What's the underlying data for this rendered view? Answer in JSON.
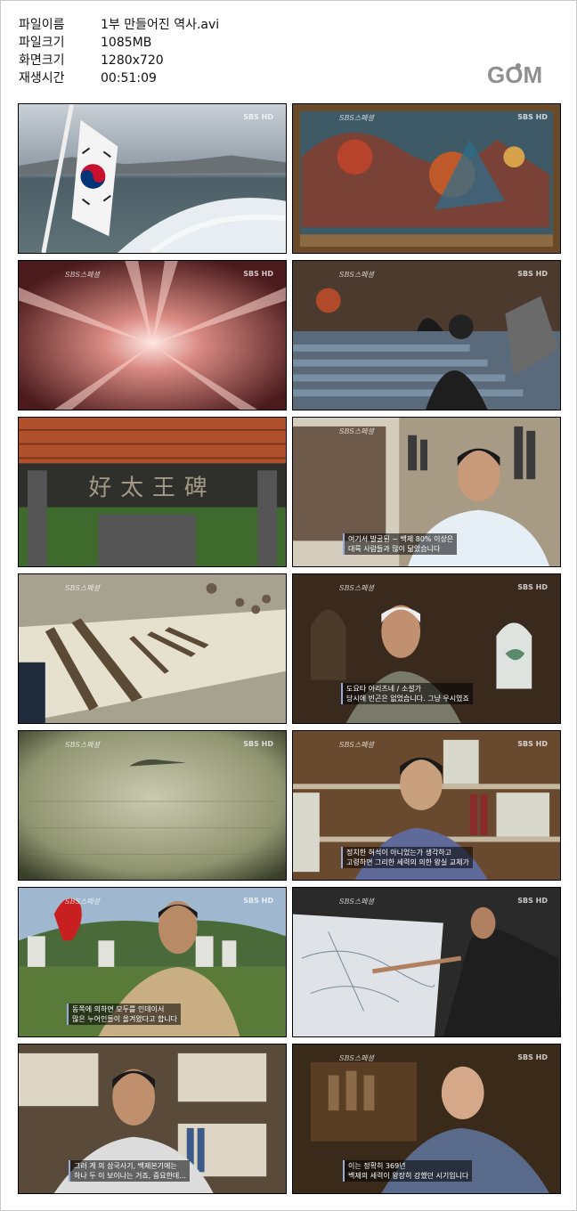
{
  "info": {
    "rows": [
      {
        "label": "파일이름",
        "value": "1부 만들어진 역사.avi"
      },
      {
        "label": "파일크기",
        "value": "1085MB"
      },
      {
        "label": "화면크기",
        "value": "1280x720"
      },
      {
        "label": "재생시간",
        "value": "00:51:09"
      }
    ]
  },
  "logo": {
    "text": "GOM"
  },
  "watermarks": {
    "left": "SBS스페셜",
    "right": "SBS HD"
  },
  "thumbnails": [
    {
      "scene": "ferry-flag",
      "captions": []
    },
    {
      "scene": "painting",
      "captions": []
    },
    {
      "scene": "light-rays",
      "captions": []
    },
    {
      "scene": "throne-room",
      "captions": []
    },
    {
      "scene": "gate-sign",
      "sign": "好太王碑",
      "captions": []
    },
    {
      "scene": "office-interview",
      "captions": [
        "여기서 발굴된 ~ 백제 80% 이상은",
        "대륙 사람들과 많이 닮았습니다"
      ]
    },
    {
      "scene": "museum-display",
      "captions": []
    },
    {
      "scene": "old-man-interview",
      "captions": [
        "도요타 아리츠네 / 소설가",
        "당시에 빈곤은 없었습니다. 그냥 우시였죠"
      ]
    },
    {
      "scene": "island-sea",
      "captions": []
    },
    {
      "scene": "bookshelf-interview",
      "captions": [
        "정치한 혀석이 아니었는가 생각하고",
        "고령하면 그리한 세력의 의한 왕실 교체가"
      ]
    },
    {
      "scene": "outdoor-interview",
      "captions": [
        "동쪽에 의하면 모두를 인데이서",
        "많은 누어인들이 올겨왔다고 합니다"
      ]
    },
    {
      "scene": "map-presentation",
      "captions": []
    },
    {
      "scene": "library-interview",
      "captions": [
        "그러 게 의 삼국사기, 백제본기에는",
        "하나 두 이 보이나는 거죠, 중요한데..."
      ]
    },
    {
      "scene": "monk-interview",
      "captions": [
        "이는 정확히 369년",
        "백제의 세력이 왕장히 강했던 시기입니다"
      ]
    }
  ]
}
